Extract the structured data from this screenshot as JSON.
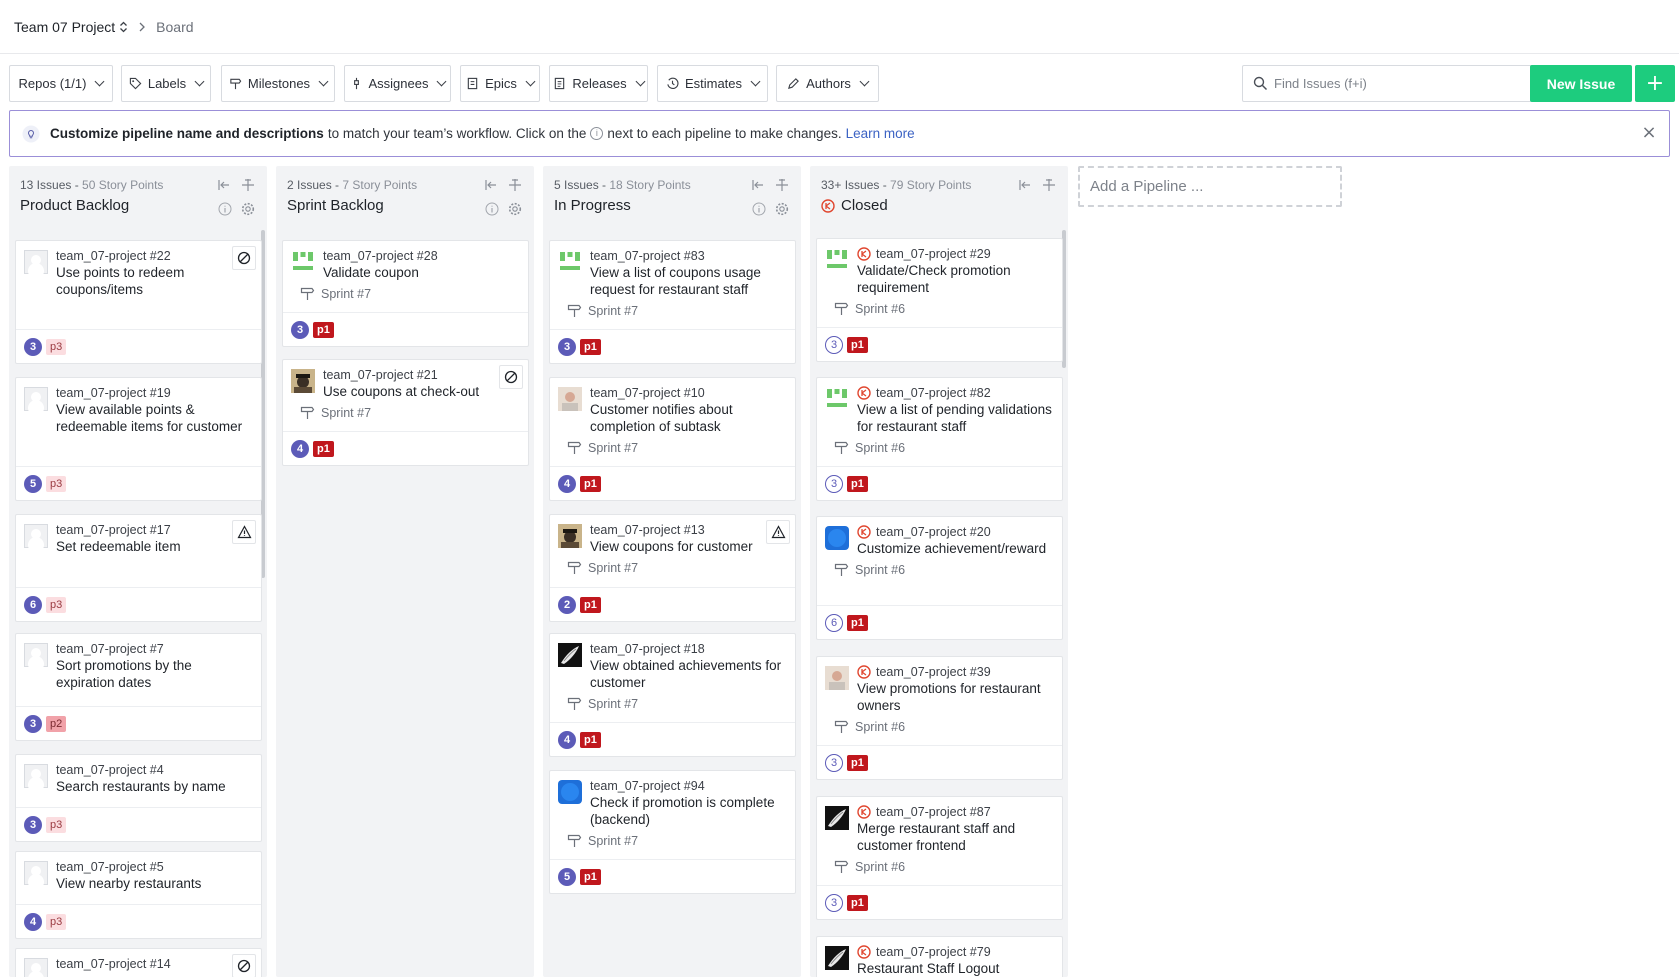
{
  "breadcrumb": {
    "project": "Team 07 Project",
    "page": "Board"
  },
  "toolbar": {
    "filters": [
      {
        "label": "Repos (1/1)",
        "icon": ""
      },
      {
        "label": "Labels",
        "icon": "tag-icon"
      },
      {
        "label": "Milestones",
        "icon": "milestone-icon"
      },
      {
        "label": "Assignees",
        "icon": "assignee-icon"
      },
      {
        "label": "Epics",
        "icon": "epic-icon"
      },
      {
        "label": "Releases",
        "icon": "release-icon"
      },
      {
        "label": "Estimates",
        "icon": "estimate-icon"
      },
      {
        "label": "Authors",
        "icon": "pencil-icon"
      }
    ],
    "search_placeholder": "Find Issues (f+i)",
    "new_issue_label": "New Issue",
    "plus_label": "+"
  },
  "banner": {
    "bold": "Customize pipeline name and descriptions",
    "text1": "to match your team’s workflow. Click on the",
    "text2": "next to each pipeline to make changes.",
    "link": "Learn more"
  },
  "add_pipeline_label": "Add a Pipeline ...",
  "pipelines": [
    {
      "issues": "13 Issues",
      "points": "50 Story Points",
      "name": "Product Backlog",
      "cards": [
        {
          "ref": "team_07-project #22",
          "title": "Use points to redeem coupons/items",
          "estimate": "3",
          "label": "p3",
          "flag": "blocked"
        },
        {
          "ref": "team_07-project #19",
          "title": "View available points & redeemable items for customer",
          "estimate": "5",
          "label": "p3"
        },
        {
          "ref": "team_07-project #17",
          "title": "Set redeemable item",
          "estimate": "6",
          "label": "p3",
          "flag": "warning"
        },
        {
          "ref": "team_07-project #7",
          "title": "Sort promotions by the expiration dates",
          "estimate": "3",
          "label": "p2"
        },
        {
          "ref": "team_07-project #4",
          "title": "Search restaurants by name",
          "estimate": "3",
          "label": "p3"
        },
        {
          "ref": "team_07-project #5",
          "title": "View nearby restaurants",
          "estimate": "4",
          "label": "p3"
        },
        {
          "ref": "team_07-project #14",
          "title": "",
          "flag": "blocked"
        }
      ]
    },
    {
      "issues": "2 Issues",
      "points": "7 Story Points",
      "name": "Sprint Backlog",
      "cards": [
        {
          "ref": "team_07-project #28",
          "title": "Validate coupon",
          "sprint": "Sprint #7",
          "estimate": "3",
          "label": "p1"
        },
        {
          "ref": "team_07-project #21",
          "title": "Use coupons at check-out",
          "sprint": "Sprint #7",
          "estimate": "4",
          "label": "p1",
          "flag": "blocked"
        }
      ]
    },
    {
      "issues": "5 Issues",
      "points": "18 Story Points",
      "name": "In Progress",
      "cards": [
        {
          "ref": "team_07-project #83",
          "title": "View a list of coupons usage request for restaurant staff",
          "sprint": "Sprint #7",
          "estimate": "3",
          "label": "p1"
        },
        {
          "ref": "team_07-project #10",
          "title": "Customer notifies about completion of subtask",
          "sprint": "Sprint #7",
          "estimate": "4",
          "label": "p1"
        },
        {
          "ref": "team_07-project #13",
          "title": "View coupons for customer",
          "sprint": "Sprint #7",
          "estimate": "2",
          "label": "p1",
          "flag": "warning"
        },
        {
          "ref": "team_07-project #18",
          "title": "View obtained achievements for customer",
          "sprint": "Sprint #7",
          "estimate": "4",
          "label": "p1"
        },
        {
          "ref": "team_07-project #94",
          "title": "Check if promotion is complete (backend)",
          "sprint": "Sprint #7",
          "estimate": "5",
          "label": "p1"
        }
      ]
    },
    {
      "issues": "33+ Issues",
      "points": "79 Story Points",
      "name": "Closed",
      "cards": [
        {
          "ref": "team_07-project #29",
          "title": "Validate/Check promotion requirement",
          "sprint": "Sprint #6",
          "estimate": "3",
          "label": "p1"
        },
        {
          "ref": "team_07-project #82",
          "title": "View a list of pending validations for restaurant staff",
          "sprint": "Sprint #6",
          "estimate": "3",
          "label": "p1"
        },
        {
          "ref": "team_07-project #20",
          "title": "Customize achievement/reward",
          "sprint": "Sprint #6",
          "estimate": "6",
          "label": "p1"
        },
        {
          "ref": "team_07-project #39",
          "title": "View promotions for restaurant owners",
          "sprint": "Sprint #6",
          "estimate": "3",
          "label": "p1"
        },
        {
          "ref": "team_07-project #87",
          "title": "Merge restaurant staff and customer frontend",
          "sprint": "Sprint #6",
          "estimate": "3",
          "label": "p1"
        },
        {
          "ref": "team_07-project #79",
          "title": "Restaurant Staff Logout"
        }
      ]
    }
  ],
  "colors": {
    "accent": "#1dcc7e",
    "estimate": "#5c5bb8",
    "p1": "#c0171d",
    "closed": "#e0462f",
    "banner_border": "#9b8fd8"
  }
}
